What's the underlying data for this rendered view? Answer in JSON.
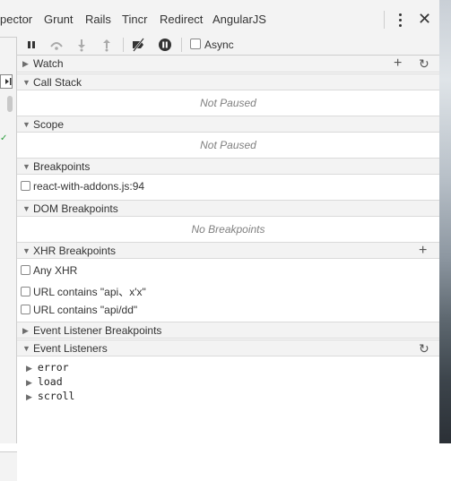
{
  "tabs": [
    "pector",
    "Grunt",
    "Rails",
    "Tincr",
    "Redirect",
    "AngularJS"
  ],
  "toolbar": {
    "async_label": "Async"
  },
  "sections": {
    "watch": {
      "title": "Watch"
    },
    "call_stack": {
      "title": "Call Stack",
      "empty": "Not Paused"
    },
    "scope": {
      "title": "Scope",
      "empty": "Not Paused"
    },
    "breakpoints": {
      "title": "Breakpoints",
      "items": [
        "react-with-addons.js:94"
      ]
    },
    "dom_breakpoints": {
      "title": "DOM Breakpoints",
      "empty": "No Breakpoints"
    },
    "xhr_breakpoints": {
      "title": "XHR Breakpoints",
      "items": [
        "Any XHR",
        "URL contains \"api、x'x\"",
        "URL contains \"api/dd\""
      ]
    },
    "event_listener_breakpoints": {
      "title": "Event Listener Breakpoints"
    },
    "event_listeners": {
      "title": "Event Listeners",
      "items": [
        "error",
        "load",
        "scroll"
      ]
    }
  }
}
